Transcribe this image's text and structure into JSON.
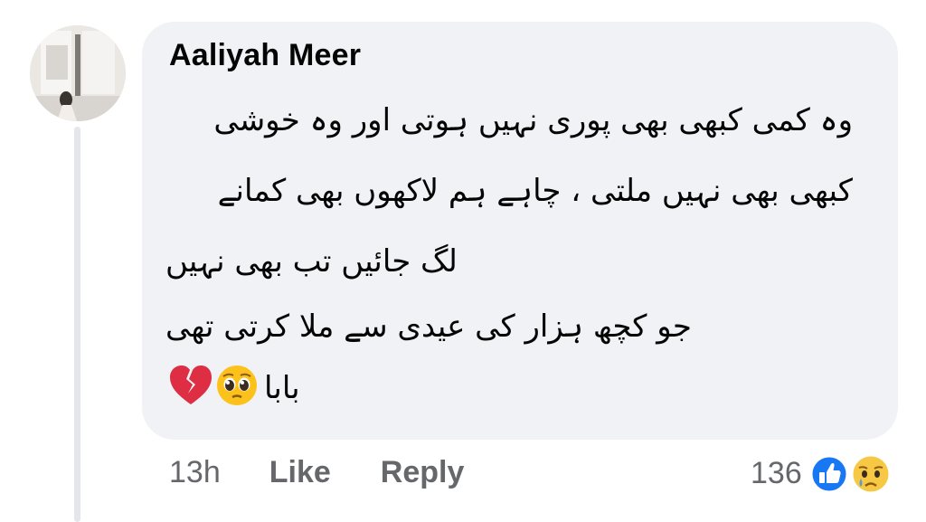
{
  "comment": {
    "author": "Aaliyah Meer",
    "lines": [
      "وہ کمی کبھی بھی پوری نہیں ہوتی اور وہ خوشی",
      "کبھی بھی نہیں ملتی ، چاہے ہم لاکھوں بھی کمانے",
      "لگ جائیں تب بھی نہیں",
      "جو کچھ ہزار کی عیدی سے ملا کرتی تھی",
      "بابا"
    ],
    "trailing_emojis": [
      "pleading-face-emoji",
      "broken-heart-emoji"
    ]
  },
  "actions": {
    "timestamp": "13h",
    "like_label": "Like",
    "reply_label": "Reply"
  },
  "reactions": {
    "count": "136",
    "types": [
      "like",
      "sad"
    ]
  },
  "colors": {
    "bubble": "#f0f2f5",
    "meta_text": "#65676b",
    "like_blue": "#1877f2"
  }
}
